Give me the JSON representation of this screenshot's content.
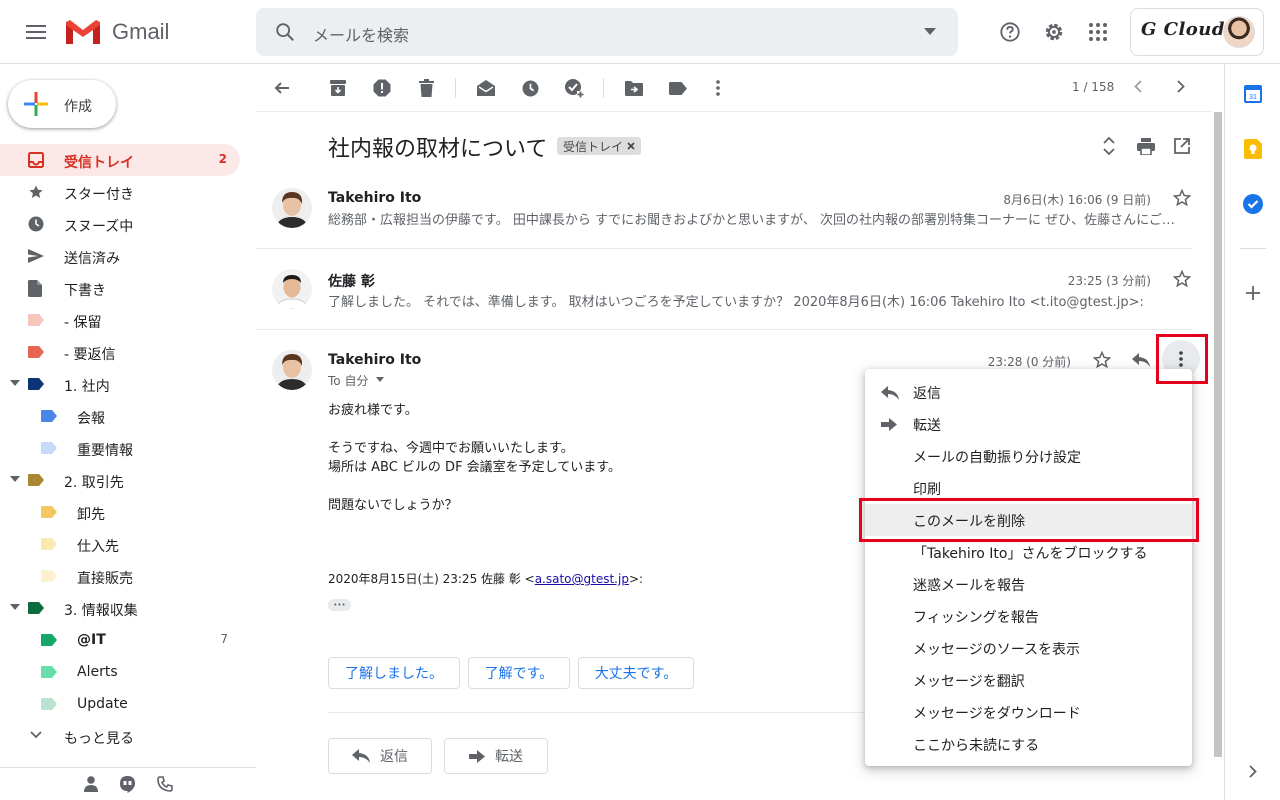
{
  "header": {
    "app_name": "Gmail",
    "search_placeholder": "メールを検索",
    "account_brand": "G Cloud"
  },
  "sidebar": {
    "compose_label": "作成",
    "items": [
      {
        "label": "受信トレイ",
        "count": "2",
        "icon": "inbox-icon",
        "active": true
      },
      {
        "label": "スター付き",
        "icon": "star-icon"
      },
      {
        "label": "スヌーズ中",
        "icon": "clock-icon"
      },
      {
        "label": "送信済み",
        "icon": "send-icon"
      },
      {
        "label": "下書き",
        "icon": "draft-icon"
      },
      {
        "label": "- 保留",
        "color": "#f6c5be"
      },
      {
        "label": "- 要返信",
        "color": "#e66550"
      },
      {
        "label": "1. 社内",
        "color": "#0d3472",
        "expandable": true
      },
      {
        "label": "会報",
        "color": "#4a86e8",
        "nested": true
      },
      {
        "label": "重要情報",
        "color": "#c9daf8",
        "nested": true
      },
      {
        "label": "2. 取引先",
        "color": "#aa8831",
        "expandable": true
      },
      {
        "label": "卸先",
        "color": "#f2c960",
        "nested": true
      },
      {
        "label": "仕入先",
        "color": "#fce8b3",
        "nested": true
      },
      {
        "label": "直接販売",
        "color": "#fef1d1",
        "nested": true
      },
      {
        "label": "3. 情報収集",
        "color": "#0b6b3f",
        "expandable": true
      },
      {
        "label": "@IT",
        "count": "7",
        "color": "#16a766",
        "nested": true,
        "bold": true
      },
      {
        "label": "Alerts",
        "color": "#68dfa9",
        "nested": true
      },
      {
        "label": "Update",
        "color": "#b9e4d0",
        "nested": true
      },
      {
        "label": "もっと見る",
        "icon": "chevron-down-icon"
      }
    ]
  },
  "toolbar": {
    "pager": "1 / 158"
  },
  "thread": {
    "subject": "社内報の取材について",
    "label_chip": "受信トレイ",
    "messages": [
      {
        "sender": "Takehiro Ito",
        "date": "8月6日(木) 16:06 (9 日前)",
        "snippet": "総務部・広報担当の伊藤です。 田中課長から すでにお聞きおよびかと思いますが、 次回の社内報の部署別特集コーナーに ぜひ、佐藤さんにご…"
      },
      {
        "sender": "佐藤 彰",
        "date": "23:25 (3 分前)",
        "snippet": "了解しました。 それでは、準備します。 取材はいつごろを予定していますか？ 2020年8月6日(木) 16:06 Takehiro Ito <t.ito@gtest.jp>:"
      },
      {
        "sender": "Takehiro Ito",
        "date": "23:28 (0 分前)",
        "to": "To 自分",
        "body": [
          "お疲れ様です。",
          "そうですね、今週中でお願いいたします。",
          "場所は ABC ビルの DF 会議室を予定しています。",
          "問題ないでしょうか？"
        ],
        "quote_header": "2020年8月15日(土) 23:25 佐藤 彰 <",
        "quote_email": "a.sato@gtest.jp",
        "quote_tail": ">:",
        "ellipsis": "•••"
      }
    ],
    "smart_replies": [
      "了解しました。",
      "了解です。",
      "大丈夫です。"
    ],
    "reply_label": "返信",
    "forward_label": "転送"
  },
  "menu": {
    "items": [
      {
        "label": "返信",
        "icon": "reply-icon"
      },
      {
        "label": "転送",
        "icon": "forward-icon"
      },
      {
        "label": "メールの自動振り分け設定"
      },
      {
        "label": "印刷"
      },
      {
        "label": "このメールを削除",
        "highlighted": true
      },
      {
        "label": "「Takehiro Ito」さんをブロックする"
      },
      {
        "label": "迷惑メールを報告"
      },
      {
        "label": "フィッシングを報告"
      },
      {
        "label": "メッセージのソースを表示"
      },
      {
        "label": "メッセージを翻訳"
      },
      {
        "label": "メッセージをダウンロード"
      },
      {
        "label": "ここから未読にする"
      }
    ]
  },
  "colors": {
    "gmail_red": "#d93025",
    "link_blue": "#1a73e8",
    "highlight_red": "#e5001b"
  }
}
